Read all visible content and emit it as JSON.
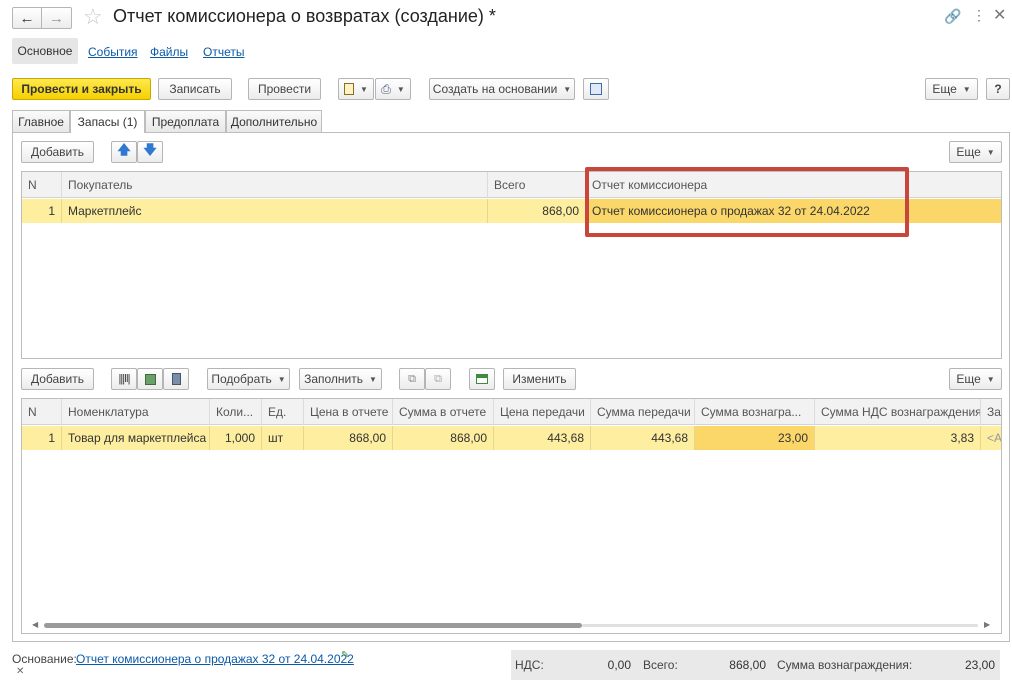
{
  "window": {
    "title": "Отчет комиссионера о возвратах (создание) *"
  },
  "nav_tabs": {
    "main": "Основное",
    "events": "События",
    "files": "Файлы",
    "reports": "Отчеты"
  },
  "toolbar": {
    "post_close": "Провести и закрыть",
    "save": "Записать",
    "post": "Провести",
    "create_based": "Создать на основании",
    "more": "Еще",
    "help": "?"
  },
  "form_tabs": {
    "general": "Главное",
    "stock": "Запасы (1)",
    "prepay": "Предоплата",
    "extra": "Дополнительно"
  },
  "top_table": {
    "add": "Добавить",
    "more": "Еще",
    "headers": {
      "n": "N",
      "buyer": "Покупатель",
      "total": "Всего",
      "report": "Отчет комиссионера"
    },
    "rows": [
      {
        "n": "1",
        "buyer": "Маркетплейс",
        "total": "868,00",
        "report": "Отчет комиссионера о продажах 32 от 24.04.2022"
      }
    ]
  },
  "bottom_table": {
    "add": "Добавить",
    "pick": "Подобрать",
    "fill": "Заполнить",
    "change": "Изменить",
    "more": "Еще",
    "headers": {
      "n": "N",
      "item": "Номенклатура",
      "qty": "Коли...",
      "unit": "Ед.",
      "price_report": "Цена в отчете",
      "sum_report": "Сумма в отчете",
      "price_transfer": "Цена передачи",
      "sum_transfer": "Сумма передачи",
      "sum_fee": "Сумма вознагра...",
      "vat_fee": "Сумма НДС вознаграждения",
      "extra": "За"
    },
    "rows": [
      {
        "n": "1",
        "item": "Товар для маркетплейса",
        "qty": "1,000",
        "unit": "шт",
        "price_report": "868,00",
        "sum_report": "868,00",
        "price_transfer": "443,68",
        "sum_transfer": "443,68",
        "sum_fee": "23,00",
        "vat_fee": "3,83",
        "extra": "<А"
      }
    ]
  },
  "footer": {
    "basis_label": "Основание:",
    "basis_link": "Отчет комиссионера о продажах 32 от 24.04.2022",
    "vat_label": "НДС:",
    "vat_value": "0,00",
    "total_label": "Всего:",
    "total_value": "868,00",
    "fee_label": "Сумма вознаграждения:",
    "fee_value": "23,00"
  },
  "colors": {
    "row_highlight": "#fdeea0",
    "cell_focus": "#fbd76a",
    "primary_button": "#f5d000",
    "callout_border": "#c9463d",
    "link": "#0b5aa8"
  }
}
